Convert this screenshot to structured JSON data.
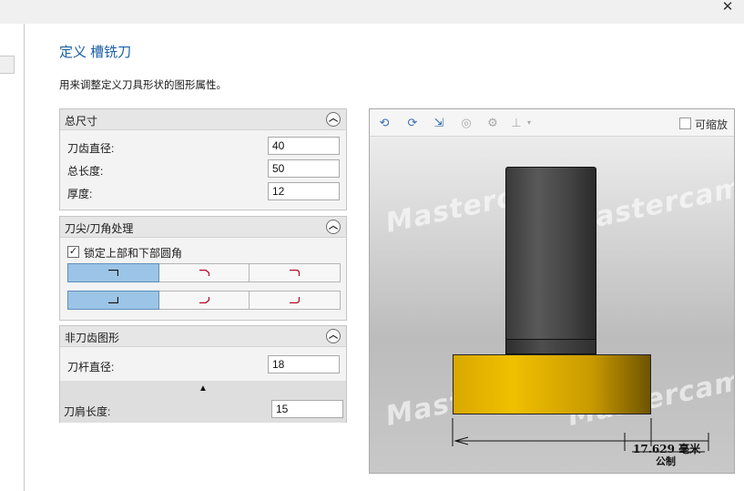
{
  "dialog": {
    "title": "定义 槽铣刀",
    "description": "用来调整定义刀具形状的图形属性。",
    "close_glyph": "✕"
  },
  "overall_size": {
    "title": "总尺寸",
    "fields": [
      {
        "label": "刀齿直径:",
        "value": "40"
      },
      {
        "label": "总长度:",
        "value": "50"
      },
      {
        "label": "厚度:",
        "value": "12"
      }
    ]
  },
  "tip_corner": {
    "title": "刀尖/刀角处理",
    "lock_label": "锁定上部和下部圆角",
    "lock_checked": true,
    "upper_options": [
      "square",
      "chamfer",
      "radius"
    ],
    "lower_options": [
      "square",
      "chamfer",
      "radius"
    ],
    "upper_selected": 0,
    "lower_selected": 0
  },
  "non_cutting": {
    "title": "非刀齿图形",
    "shank_label": "刀杆直径:",
    "shank_value": "18",
    "shoulder_label": "刀肩长度:",
    "shoulder_value": "15"
  },
  "preview": {
    "zoom_label": "可缩放",
    "zoom_checked": false,
    "watermark": "Mastercam",
    "dimension_value": "17.629 毫米",
    "dimension_unit": "公制",
    "toolbar_icons": [
      "rotate-left-icon",
      "rotate-right-icon",
      "export-icon",
      "view-icon",
      "settings-icon",
      "tool-icon"
    ],
    "colors": {
      "flute": "#e8b800",
      "shank": "#4a4a4a",
      "accent": "#1b5fa8"
    }
  }
}
